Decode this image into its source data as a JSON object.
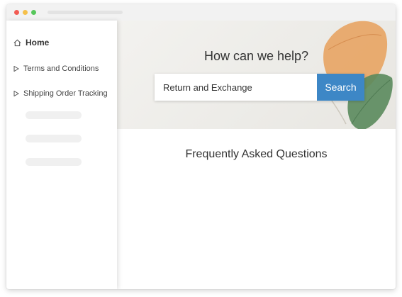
{
  "sidebar": {
    "home_label": "Home",
    "items": [
      {
        "label": "Terms and Conditions"
      },
      {
        "label": "Shipping Order Tracking"
      }
    ]
  },
  "hero": {
    "title": "How can we help?",
    "search_value": "Return and Exchange",
    "search_button": "Search"
  },
  "faq": {
    "title": "Frequently Asked Questions"
  },
  "colors": {
    "accent": "#3d87c6",
    "leaf_orange": "#e8a05a",
    "leaf_green": "#5a8a5c"
  }
}
